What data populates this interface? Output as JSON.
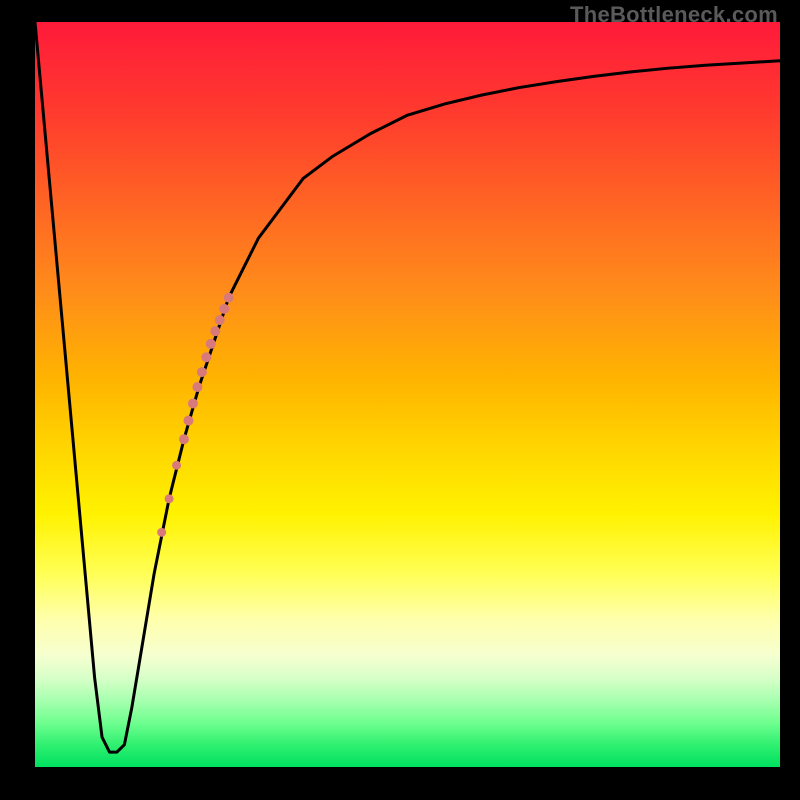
{
  "attribution": "TheBottleneck.com",
  "chart_data": {
    "type": "line",
    "title": "",
    "xlabel": "",
    "ylabel": "",
    "xlim": [
      0,
      100
    ],
    "ylim": [
      0,
      100
    ],
    "grid": false,
    "series": [
      {
        "name": "bottleneck-curve",
        "x": [
          0,
          1,
          2,
          3,
          4,
          5,
          6,
          7,
          8,
          9,
          10,
          11,
          12,
          13,
          14,
          16,
          18,
          20,
          22,
          24,
          26,
          28,
          30,
          33,
          36,
          40,
          45,
          50,
          55,
          60,
          65,
          70,
          75,
          80,
          85,
          90,
          95,
          100
        ],
        "values": [
          100,
          89,
          78,
          67,
          56,
          45,
          34,
          23,
          12,
          4,
          2,
          2,
          3,
          8,
          14,
          26,
          36,
          44,
          51,
          57,
          63,
          67,
          71,
          75,
          79,
          82,
          85,
          87.5,
          89,
          90.2,
          91.2,
          92,
          92.7,
          93.3,
          93.8,
          94.2,
          94.5,
          94.8
        ]
      }
    ],
    "annotations": [
      {
        "name": "highlight-segment",
        "type": "points-on-curve",
        "color": "#d97a7a",
        "points": [
          {
            "x": 17.0,
            "y": 31.5,
            "r": 4.5
          },
          {
            "x": 18.0,
            "y": 36.0,
            "r": 4.5
          },
          {
            "x": 19.0,
            "y": 40.5,
            "r": 4.5
          },
          {
            "x": 20.0,
            "y": 44.0,
            "r": 5.0
          },
          {
            "x": 20.6,
            "y": 46.5,
            "r": 5.0
          },
          {
            "x": 21.2,
            "y": 48.8,
            "r": 5.0
          },
          {
            "x": 21.8,
            "y": 51.0,
            "r": 5.0
          },
          {
            "x": 22.4,
            "y": 53.0,
            "r": 5.0
          },
          {
            "x": 23.0,
            "y": 55.0,
            "r": 5.0
          },
          {
            "x": 23.6,
            "y": 56.8,
            "r": 5.0
          },
          {
            "x": 24.2,
            "y": 58.5,
            "r": 5.0
          },
          {
            "x": 24.8,
            "y": 60.0,
            "r": 5.0
          },
          {
            "x": 25.4,
            "y": 61.5,
            "r": 5.0
          },
          {
            "x": 26.0,
            "y": 63.0,
            "r": 5.0
          }
        ]
      }
    ]
  }
}
